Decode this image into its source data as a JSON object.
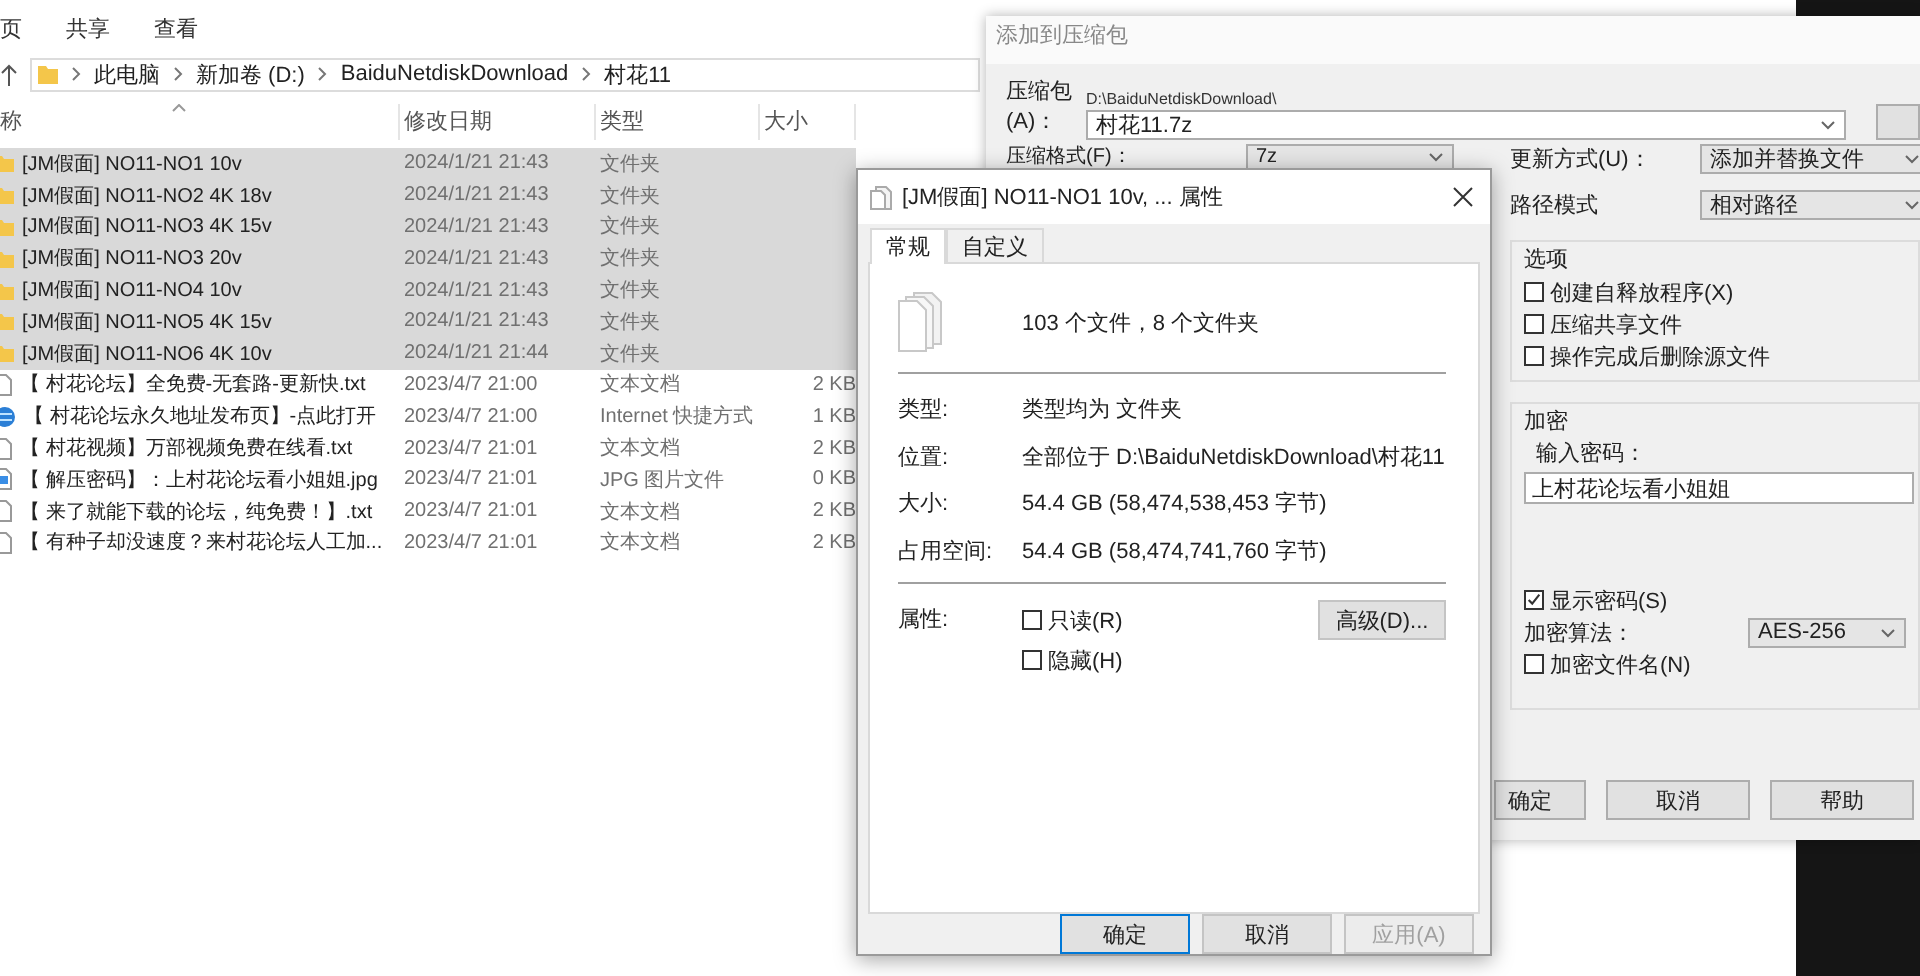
{
  "explorer": {
    "menu": [
      "页",
      "共享",
      "查看"
    ],
    "breadcrumb": [
      "此电脑",
      "新加卷 (D:)",
      "BaiduNetdiskDownload",
      "村花11"
    ],
    "columns": [
      "称",
      "修改日期",
      "类型",
      "大小"
    ],
    "rows": [
      {
        "kind": "folder",
        "name": "[JM假面] NO11-NO1 10v",
        "date": "2024/1/21 21:43",
        "type": "文件夹",
        "selected": true
      },
      {
        "kind": "folder",
        "name": "[JM假面] NO11-NO2 4K 18v",
        "date": "2024/1/21 21:43",
        "type": "文件夹",
        "selected": true
      },
      {
        "kind": "folder",
        "name": "[JM假面] NO11-NO3 4K 15v",
        "date": "2024/1/21 21:43",
        "type": "文件夹",
        "selected": true
      },
      {
        "kind": "folder",
        "name": "[JM假面] NO11-NO3 20v",
        "date": "2024/1/21 21:43",
        "type": "文件夹",
        "selected": true
      },
      {
        "kind": "folder",
        "name": "[JM假面] NO11-NO4 10v",
        "date": "2024/1/21 21:43",
        "type": "文件夹",
        "selected": true
      },
      {
        "kind": "folder",
        "name": "[JM假面] NO11-NO5 4K 15v",
        "date": "2024/1/21 21:43",
        "type": "文件夹",
        "selected": true
      },
      {
        "kind": "folder",
        "name": "[JM假面] NO11-NO6 4K 10v",
        "date": "2024/1/21 21:44",
        "type": "文件夹",
        "selected": true
      },
      {
        "kind": "text",
        "name": "【 村花论坛】全免费-无套路-更新快.txt",
        "date": "2023/4/7 21:00",
        "type": "文本文档",
        "size": "2 KB",
        "selected": false
      },
      {
        "kind": "link",
        "name": "【 村花论坛永久地址发布页】-点此打开",
        "date": "2023/4/7 21:00",
        "type": "Internet 快捷方式",
        "size": "1 KB",
        "selected": false
      },
      {
        "kind": "text",
        "name": "【 村花视频】万部视频免费在线看.txt",
        "date": "2023/4/7 21:01",
        "type": "文本文档",
        "size": "2 KB",
        "selected": false
      },
      {
        "kind": "image",
        "name": "【 解压密码】：上村花论坛看小姐姐.jpg",
        "date": "2023/4/7 21:01",
        "type": "JPG 图片文件",
        "size": "0 KB",
        "selected": false
      },
      {
        "kind": "text",
        "name": "【 来了就能下载的论坛，纯免费！】.txt",
        "date": "2023/4/7 21:01",
        "type": "文本文档",
        "size": "2 KB",
        "selected": false
      },
      {
        "kind": "text",
        "name": "【 有种子却没速度？来村花论坛人工加...",
        "date": "2023/4/7 21:01",
        "type": "文本文档",
        "size": "2 KB",
        "selected": false
      }
    ]
  },
  "archive": {
    "title": "添加到压缩包",
    "archive_label": "压缩包(A)：",
    "archive_dir": "D:\\BaiduNetdiskDownload\\",
    "archive_name": "村花11.7z",
    "format_label": "压缩格式(F)：",
    "format_value": "7z",
    "update_label": "更新方式(U)：",
    "update_value": "添加并替换文件",
    "path_label": "路径模式",
    "path_value": "相对路径",
    "options_title": "选项",
    "options": [
      {
        "label": "创建自释放程序(X)",
        "checked": false
      },
      {
        "label": "压缩共享文件",
        "checked": false
      },
      {
        "label": "操作完成后删除源文件",
        "checked": false
      }
    ],
    "encryption_title": "加密",
    "password_label": "输入密码：",
    "password": "上村花论坛看小姐姐",
    "show_password": {
      "label": "显示密码(S)",
      "checked": true
    },
    "algorithm_label": "加密算法：",
    "algorithm_value": "AES-256",
    "encrypt_names": {
      "label": "加密文件名(N)",
      "checked": false
    },
    "buttons": [
      "确定",
      "取消",
      "帮助"
    ]
  },
  "properties": {
    "title": "[JM假面] NO11-NO1 10v, ... 属性",
    "tabs": [
      {
        "label": "常规",
        "selected": true
      },
      {
        "label": "自定义",
        "selected": false
      }
    ],
    "summary": "103 个文件，8 个文件夹",
    "fields": [
      {
        "label": "类型:",
        "value": "类型均为 文件夹"
      },
      {
        "label": "位置:",
        "value": "全部位于 D:\\BaiduNetdiskDownload\\村花11"
      },
      {
        "label": "大小:",
        "value": "54.4 GB (58,474,538,453 字节)"
      },
      {
        "label": "占用空间:",
        "value": "54.4 GB (58,474,741,760 字节)"
      }
    ],
    "attributes_label": "属性:",
    "attributes": [
      {
        "label": "只读(R)",
        "checked": false
      },
      {
        "label": "隐藏(H)",
        "checked": false
      }
    ],
    "advanced_button": "高级(D)...",
    "buttons": [
      {
        "label": "确定",
        "focused": true,
        "disabled": false
      },
      {
        "label": "取消",
        "focused": false,
        "disabled": false
      },
      {
        "label": "应用(A)",
        "focused": false,
        "disabled": true
      }
    ]
  }
}
